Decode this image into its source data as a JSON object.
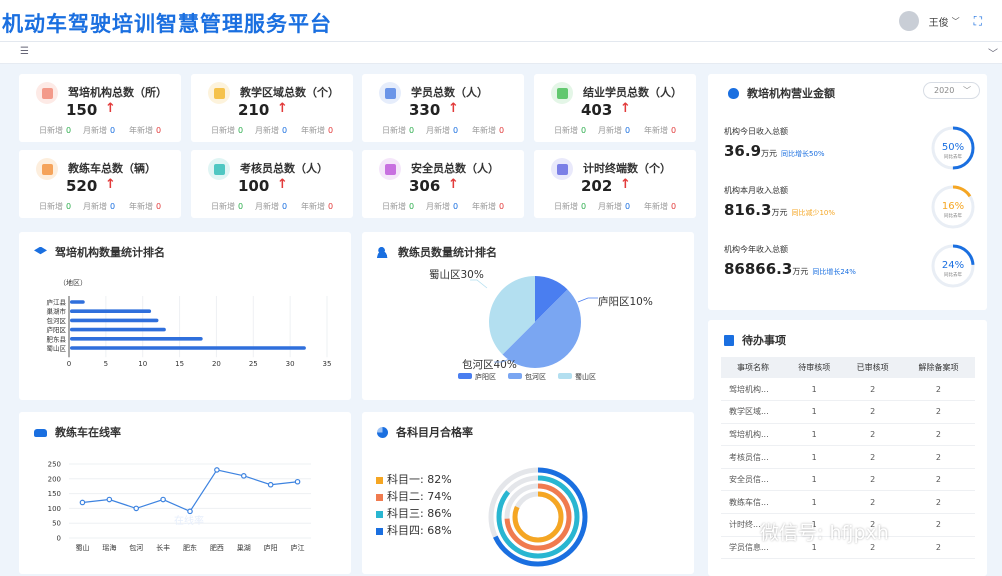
{
  "header": {
    "title": "机动车驾驶培训智慧管理服务平台",
    "user_name": "王俊"
  },
  "stats": [
    {
      "label": "驾培机构总数（所）",
      "value": "150",
      "color": "#f39a8a",
      "bg": "#fdeae6",
      "day_label": "日新增",
      "day": "0",
      "month_label": "月新增",
      "month": "0",
      "year_label": "年新增",
      "year": "0"
    },
    {
      "label": "教学区域总数（个）",
      "value": "210",
      "color": "#f5c24b",
      "bg": "#fdf3dc",
      "day_label": "日新增",
      "day": "0",
      "month_label": "月新增",
      "month": "0",
      "year_label": "年新增",
      "year": "0"
    },
    {
      "label": "学员总数（人）",
      "value": "330",
      "color": "#6b95e8",
      "bg": "#e6edfb",
      "day_label": "日新增",
      "day": "0",
      "month_label": "月新增",
      "month": "0",
      "year_label": "年新增",
      "year": "0"
    },
    {
      "label": "结业学员总数（人）",
      "value": "403",
      "color": "#62c86f",
      "bg": "#e4f6e7",
      "day_label": "日新增",
      "day": "0",
      "month_label": "月新增",
      "month": "0",
      "year_label": "年新增",
      "year": "0"
    },
    {
      "label": "教练车总数（辆）",
      "value": "520",
      "color": "#f5a35a",
      "bg": "#fdeedd",
      "day_label": "日新增",
      "day": "0",
      "month_label": "月新增",
      "month": "0",
      "year_label": "年新增",
      "year": "0"
    },
    {
      "label": "考核员总数（人）",
      "value": "100",
      "color": "#4fc7c2",
      "bg": "#e0f5f4",
      "day_label": "日新增",
      "day": "0",
      "month_label": "月新增",
      "month": "0",
      "year_label": "年新增",
      "year": "0"
    },
    {
      "label": "安全员总数（人）",
      "value": "306",
      "color": "#c870e0",
      "bg": "#f5e6fa",
      "day_label": "日新增",
      "day": "0",
      "month_label": "月新增",
      "month": "0",
      "year_label": "年新增",
      "year": "0"
    },
    {
      "label": "计时终端数（个）",
      "value": "202",
      "color": "#7b7fe6",
      "bg": "#e9e9fb",
      "day_label": "日新增",
      "day": "0",
      "month_label": "月新增",
      "month": "0",
      "year_label": "年新增",
      "year": "0"
    }
  ],
  "revenue": {
    "title": "教培机构营业金额",
    "year": "2020",
    "rows": [
      {
        "label": "机构今日收入总额",
        "value": "36.9",
        "unit": "万元",
        "note": "同比增长50%",
        "pct": "50%",
        "pct_num": 50,
        "ring_label": "同比去年",
        "color": "#1a6fe0"
      },
      {
        "label": "机构本月收入总额",
        "value": "816.3",
        "unit": "万元",
        "note": "同比减少10%",
        "pct": "16%",
        "pct_num": 16,
        "ring_label": "同比去年",
        "color": "#f5a623"
      },
      {
        "label": "机构今年收入总额",
        "value": "86866.3",
        "unit": "万元",
        "note": "同比增长24%",
        "pct": "24%",
        "pct_num": 24,
        "ring_label": "同比去年",
        "color": "#1a6fe0"
      }
    ]
  },
  "todo": {
    "title": "待办事项",
    "headers": [
      "事项名称",
      "待审核项",
      "已审核项",
      "解除备案项"
    ],
    "rows": [
      [
        "驾培机构...",
        "1",
        "2",
        "2"
      ],
      [
        "教学区域...",
        "1",
        "2",
        "2"
      ],
      [
        "驾培机构...",
        "1",
        "2",
        "2"
      ],
      [
        "考核员信...",
        "1",
        "2",
        "2"
      ],
      [
        "安全员信...",
        "1",
        "2",
        "2"
      ],
      [
        "教练车信...",
        "1",
        "2",
        "2"
      ],
      [
        "计时终...",
        "1",
        "2",
        "2"
      ],
      [
        "学员信息...",
        "1",
        "2",
        "2"
      ]
    ]
  },
  "chart_data": [
    {
      "type": "bar",
      "title": "驾培机构数量统计排名",
      "ylabel": "（地区）",
      "orientation": "horizontal",
      "categories": [
        "庐江县",
        "巢湖市",
        "包河区",
        "庐阳区",
        "肥东县",
        "蜀山区"
      ],
      "values": [
        2,
        11,
        12,
        13,
        18,
        32
      ],
      "xlim": [
        0,
        35
      ],
      "xticks": [
        0,
        5,
        10,
        15,
        20,
        25,
        30,
        35
      ]
    },
    {
      "type": "pie",
      "title": "教练员数量统计排名",
      "categories": [
        "庐阳区",
        "包河区",
        "蜀山区"
      ],
      "values": [
        10,
        40,
        30
      ],
      "labels": [
        "庐阳区10%",
        "包河区40%",
        "蜀山区30%"
      ],
      "colors": [
        "#4a7ef0",
        "#7aa6f2",
        "#b3dff0"
      ]
    },
    {
      "type": "line",
      "title": "教练车在线率",
      "categories": [
        "蜀山",
        "瑶海",
        "包河",
        "长丰",
        "肥东",
        "肥西",
        "巢湖",
        "庐阳",
        "庐江"
      ],
      "values": [
        120,
        130,
        100,
        130,
        90,
        230,
        210,
        180,
        190
      ],
      "ylim": [
        0,
        250
      ],
      "yticks": [
        0,
        50,
        100,
        150,
        200,
        250
      ],
      "watermark": "在线率"
    },
    {
      "type": "pie",
      "subtype": "concentric-rings",
      "title": "各科目月合格率",
      "categories": [
        "科目一",
        "科目二",
        "科目三",
        "科目四"
      ],
      "values": [
        82,
        74,
        86,
        68
      ],
      "labels": [
        "科目一: 82%",
        "科目二: 74%",
        "科目三: 86%",
        "科目四: 68%"
      ],
      "colors": [
        "#f5a623",
        "#f07b4f",
        "#29b6d1",
        "#1a6fe0"
      ]
    }
  ],
  "watermark": "微信号: hfjpxh"
}
